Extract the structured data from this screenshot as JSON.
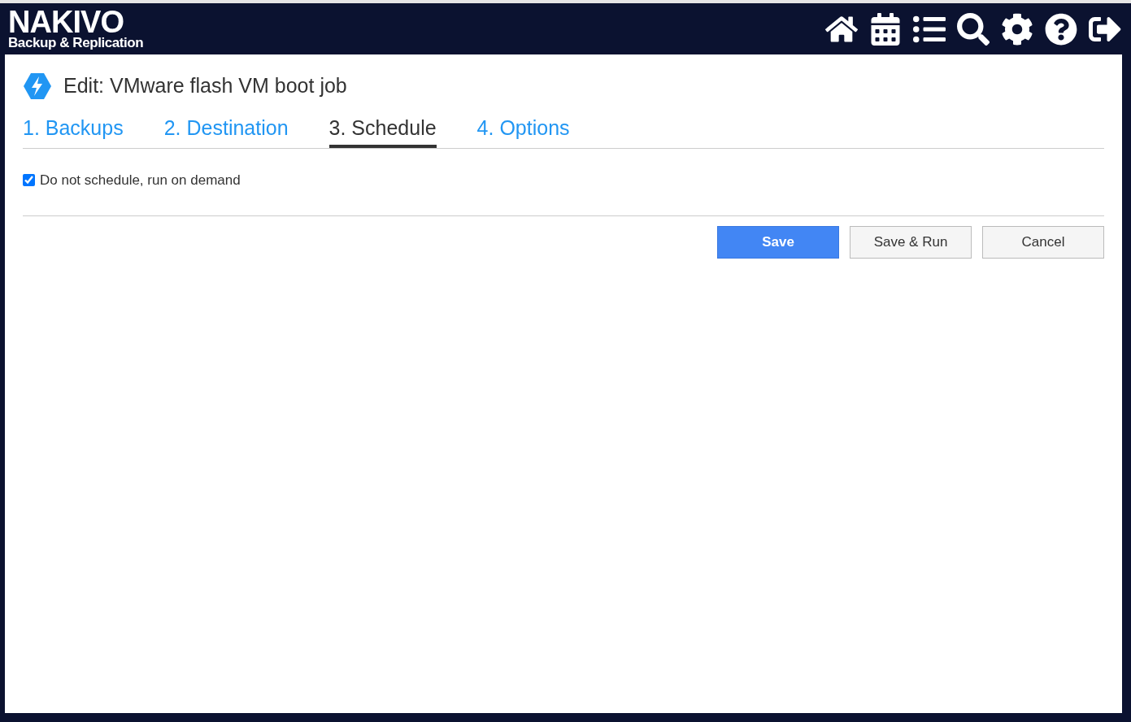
{
  "header": {
    "logo": {
      "name": "NAKIVO",
      "subtitle": "Backup & Replication"
    }
  },
  "dialog": {
    "title": "Edit: VMware flash VM boot job",
    "tabs": [
      {
        "label": "1. Backups",
        "selected": false
      },
      {
        "label": "2. Destination",
        "selected": false
      },
      {
        "label": "3. Schedule",
        "selected": true
      },
      {
        "label": "4. Options",
        "selected": false
      }
    ],
    "schedule": {
      "label": "Do not schedule, run on demand",
      "checked": true
    },
    "buttons": [
      {
        "label": "Save",
        "kind": "primary"
      },
      {
        "label": "Save & Run",
        "kind": "default"
      },
      {
        "label": "Cancel",
        "kind": "default"
      }
    ]
  }
}
